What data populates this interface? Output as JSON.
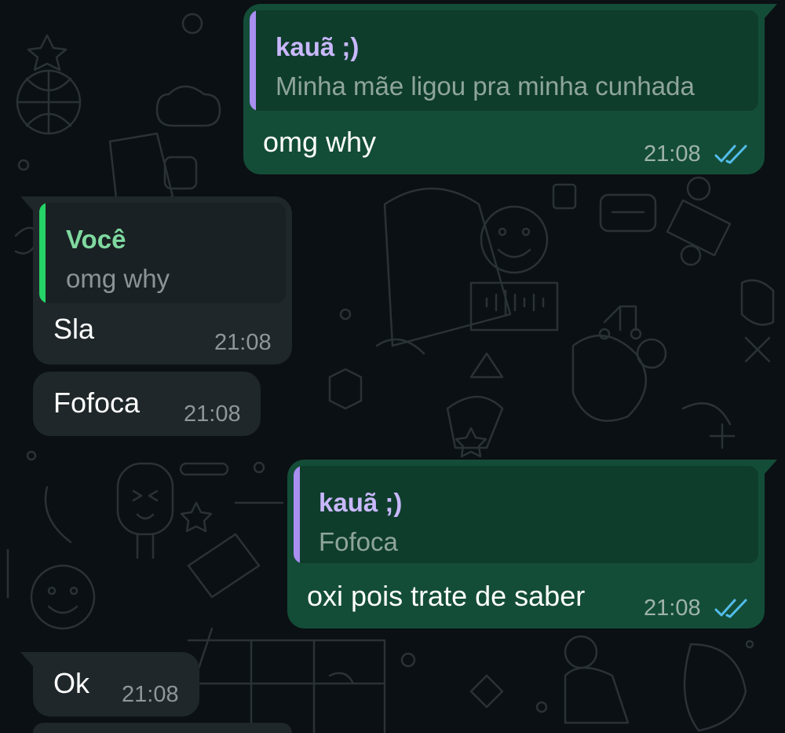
{
  "colors": {
    "background": "#0b1014",
    "outgoing_bubble": "#144d37",
    "incoming_bubble": "#1f272a",
    "quote_bar_purple": "#a88ff0",
    "quote_bar_green": "#25d366",
    "quote_author_purple": "#c9b8ff",
    "quote_author_green": "#7fd9a0",
    "read_ticks": "#53bdeb"
  },
  "messages": [
    {
      "direction": "outgoing",
      "reply_author": "kauã ;)",
      "reply_text": "Minha mãe ligou pra minha cunhada",
      "text": "omg why",
      "time": "21:08",
      "status_icon": "double-check-read-icon"
    },
    {
      "direction": "incoming",
      "reply_author": "Você",
      "reply_text": "omg why",
      "text": "Sla",
      "time": "21:08"
    },
    {
      "direction": "incoming",
      "text": "Fofoca",
      "time": "21:08"
    },
    {
      "direction": "outgoing",
      "reply_author": "kauã ;)",
      "reply_text": "Fofoca",
      "text": "oxi pois trate de saber",
      "time": "21:08",
      "status_icon": "double-check-read-icon"
    },
    {
      "direction": "incoming",
      "text": "Ok",
      "time": "21:08"
    }
  ]
}
